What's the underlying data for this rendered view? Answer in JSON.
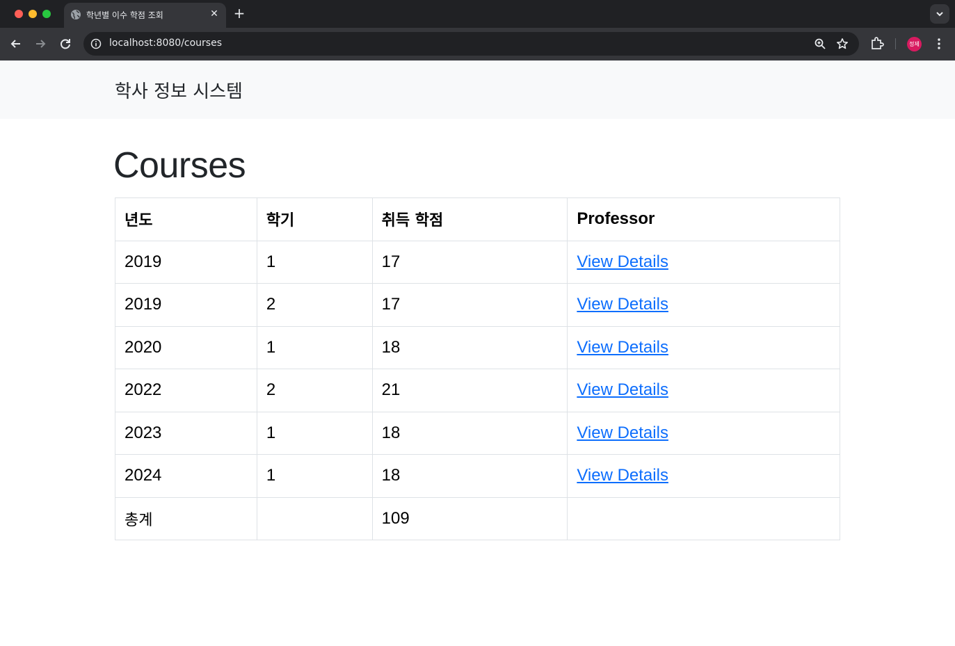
{
  "browser": {
    "tab_title": "학년별 이수 학점 조회",
    "url": "localhost:8080/courses",
    "profile_initials": "정제"
  },
  "navbar": {
    "brand": "학사 정보 시스템"
  },
  "page": {
    "heading": "Courses"
  },
  "table": {
    "headers": [
      "년도",
      "학기",
      "취득 학점",
      "Professor"
    ],
    "rows": [
      {
        "year": "2019",
        "semester": "1",
        "credits": "17",
        "link": "View Details"
      },
      {
        "year": "2019",
        "semester": "2",
        "credits": "17",
        "link": "View Details"
      },
      {
        "year": "2020",
        "semester": "1",
        "credits": "18",
        "link": "View Details"
      },
      {
        "year": "2022",
        "semester": "2",
        "credits": "21",
        "link": "View Details"
      },
      {
        "year": "2023",
        "semester": "1",
        "credits": "18",
        "link": "View Details"
      },
      {
        "year": "2024",
        "semester": "1",
        "credits": "18",
        "link": "View Details"
      }
    ],
    "total": {
      "label": "총계",
      "semester": "",
      "credits": "109",
      "link": ""
    }
  },
  "colors": {
    "link": "#0d6efd",
    "navbar_bg": "#f8f9fa",
    "profile": "#d81b60"
  }
}
